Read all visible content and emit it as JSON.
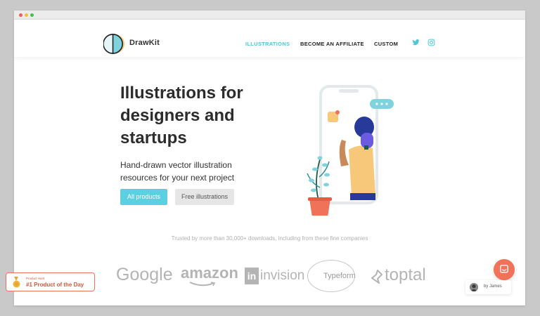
{
  "window": {
    "title": ""
  },
  "header": {
    "brand": "DrawKit",
    "nav": [
      {
        "label": "ILLUSTRATIONS",
        "active": true
      },
      {
        "label": "BECOME AN AFFILIATE",
        "active": false
      },
      {
        "label": "CUSTOM",
        "active": false
      }
    ],
    "social": [
      "twitter-icon",
      "instagram-icon"
    ]
  },
  "hero": {
    "title_lines": [
      "Illustrations for",
      "designers and",
      "startups"
    ],
    "subtitle_lines": [
      "Hand-drawn vector illustration",
      "resources for your next project"
    ],
    "primary_button": "All products",
    "secondary_button": "Free illustrations"
  },
  "trusted": {
    "text": "Trusted by more than 30,000+ downloads, including from these fine companies",
    "companies": [
      "Google",
      "amazon",
      "invision",
      "Typeform",
      "toptal"
    ]
  },
  "product_hunt": {
    "small_label": "Product Hunt",
    "label": "#1 Product of the Day"
  },
  "byline": {
    "text": "by James"
  },
  "colors": {
    "accent": "#4ec6d6",
    "button_primary": "#5bd0e0",
    "chat": "#f07259",
    "badge": "#d4583c"
  }
}
